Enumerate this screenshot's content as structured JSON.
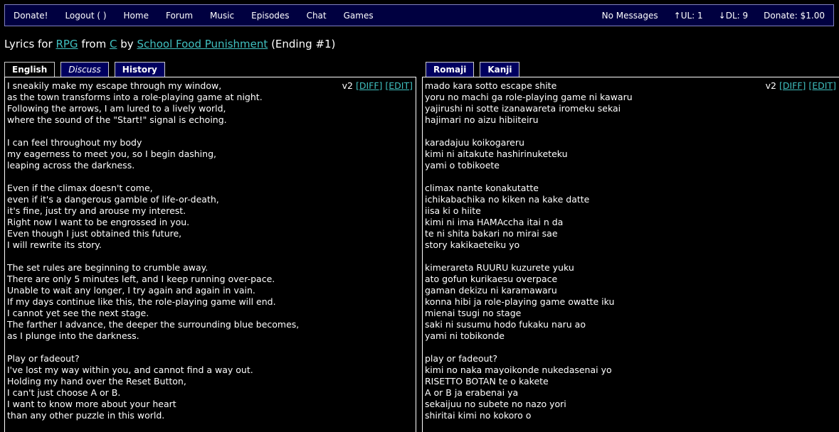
{
  "nav": {
    "donate": "Donate!",
    "logout": "Logout (        )",
    "home": "Home",
    "forum": "Forum",
    "music": "Music",
    "episodes": "Episodes",
    "chat": "Chat",
    "games": "Games"
  },
  "status": {
    "messages": "No Messages",
    "upload": "↑UL: 1",
    "download": "↓DL: 9",
    "donate": "Donate: $1.00"
  },
  "heading": {
    "prefix": "Lyrics for",
    "song": "RPG",
    "from_word": "from",
    "anime": "C",
    "by_word": "by",
    "artist": "School Food Punishment",
    "suffix": "(Ending #1)"
  },
  "left_tabs": [
    "English",
    "Discuss",
    "History"
  ],
  "right_tabs": [
    "Romaji",
    "Kanji"
  ],
  "left_panel": {
    "version": "v2",
    "diff": "[DIFF]",
    "edit": "[EDIT]",
    "lines": [
      "I sneakily make my escape through my window,",
      "as the town transforms into a role-playing game at night.",
      "Following the arrows, I am lured to a lively world,",
      "where the sound of the \"Start!\" signal is echoing.",
      "",
      "I can feel throughout my body",
      "my eagerness to meet you, so I begin dashing,",
      "leaping across the darkness.",
      "",
      "Even if the climax doesn't come,",
      "even if it's a dangerous gamble of life-or-death,",
      "it's fine, just try and arouse my interest.",
      "Right now I want to be engrossed in you.",
      "Even though I just obtained this future,",
      "I will rewrite its story.",
      "",
      "The set rules are beginning to crumble away.",
      "There are only 5 minutes left, and I keep running over-pace.",
      "Unable to wait any longer, I try again and again in vain.",
      "If my days continue like this, the role-playing game will end.",
      "I cannot yet see the next stage.",
      "The farther I advance, the deeper the surrounding blue becomes,",
      "as I plunge into the darkness.",
      "",
      "Play or fadeout?",
      "I've lost my way within you, and cannot find a way out.",
      "Holding my hand over the Reset Button,",
      "I can't just choose A or B.",
      "I want to know more about your heart",
      "than any other puzzle in this world."
    ]
  },
  "right_panel": {
    "version": "v2",
    "diff": "[DIFF]",
    "edit": "[EDIT]",
    "lines": [
      "mado kara sotto escape shite",
      "yoru no machi ga role-playing game ni kawaru",
      "yajirushi ni sotte izanawareta iromeku sekai",
      "hajimari no aizu hibiiteiru",
      "",
      "karadajuu koikogareru",
      "kimi ni aitakute hashirinuketeku",
      "yami o tobikoete",
      "",
      "climax nante konakutatte",
      "ichikabachika no kiken na kake datte",
      "iisa ki o hiite",
      "kimi ni ima HAMAccha itai n da",
      "te ni shita bakari no mirai sae",
      "story kakikaeteiku yo",
      "",
      "kimerareta RUURU kuzurete yuku",
      "ato gofun kurikaesu overpace",
      "gaman dekizu ni karamawaru",
      "konna hibi ja role-playing game owatte iku",
      "mienai tsugi no stage",
      "saki ni susumu hodo fukaku naru ao",
      "yami ni tobikonde",
      "",
      "play or fadeout?",
      "kimi no naka mayoikonde nukedasenai yo",
      "RISETTO BOTAN te o kakete",
      "A or B ja erabenai ya",
      "sekaijuu no subete no nazo yori",
      "shiritai kimi no kokoro o"
    ]
  }
}
